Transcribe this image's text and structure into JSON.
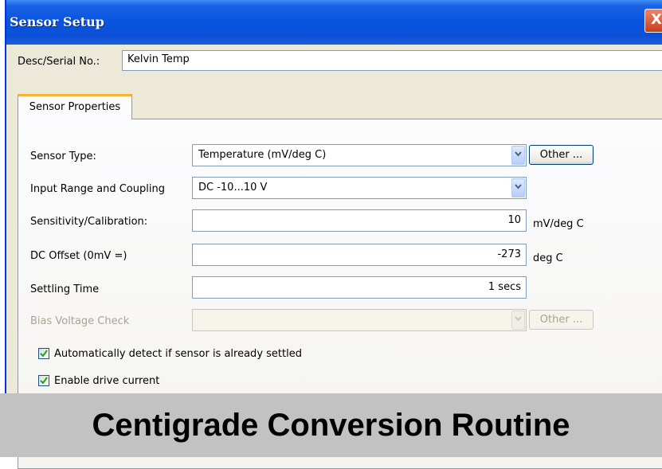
{
  "window": {
    "title": "Sensor Setup",
    "close_glyph": "X"
  },
  "desc": {
    "label": "Desc/Serial No.:",
    "value": "Kelvin Temp"
  },
  "tabs": [
    {
      "label": "Sensor Properties",
      "selected": true
    }
  ],
  "fields": {
    "sensor_type": {
      "label": "Sensor Type:",
      "value": "Temperature (mV/deg C)",
      "button": "Other ..."
    },
    "input_range": {
      "label": "Input Range and Coupling",
      "value": "DC -10...10 V"
    },
    "sensitivity": {
      "label": "Sensitivity/Calibration:",
      "value": "10",
      "unit": "mV/deg C"
    },
    "dc_offset": {
      "label": "DC Offset (0mV =)",
      "value": "-273",
      "unit": "deg C"
    },
    "settling_time": {
      "label": "Settling Time",
      "value": "1 secs"
    },
    "bias_voltage": {
      "label": "Bias Voltage Check",
      "value": "",
      "button": "Other ...",
      "disabled": true
    }
  },
  "checkboxes": {
    "auto_detect": {
      "label": "Automatically detect if sensor is already settled",
      "checked": true
    },
    "drive_current": {
      "label": "Enable drive current",
      "checked": true
    }
  },
  "banner": {
    "text": "Centigrade Conversion Routine"
  },
  "colors": {
    "titlebar": "#0a55e0",
    "dialog_bg": "#ece9d8",
    "tab_highlight": "#f8b232",
    "banner_bg": "#c2c2c2"
  }
}
